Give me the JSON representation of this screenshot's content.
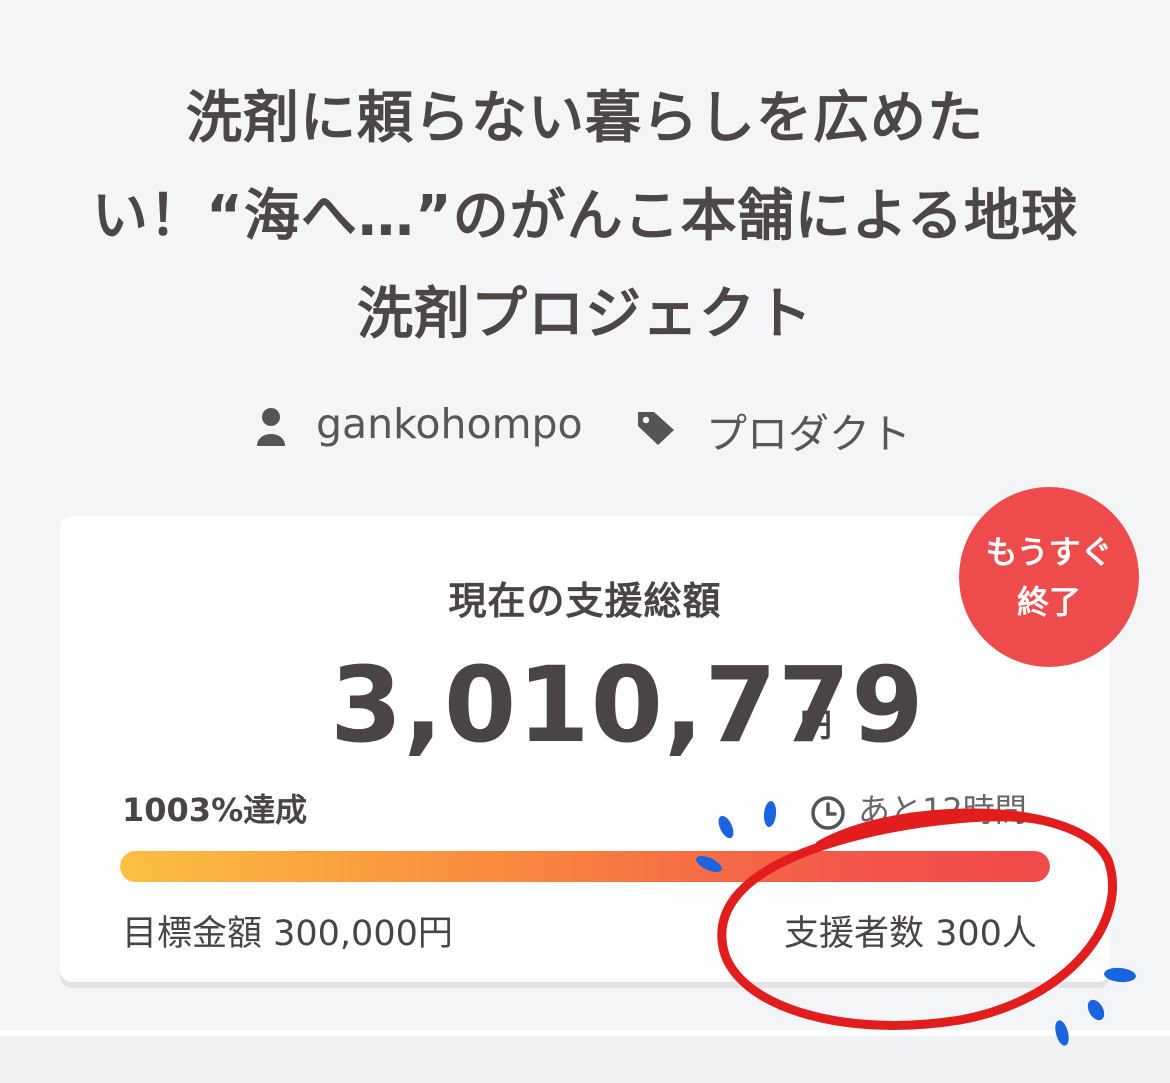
{
  "project": {
    "title_lines": [
      "洗剤に頼らない暮らしを広めた",
      "い！“海へ…”のがんこ本舗による地球",
      "洗剤プロジェクト"
    ],
    "author": "gankohompo",
    "category": "プロダクト"
  },
  "funding": {
    "badge_line1": "もうすぐ",
    "badge_line2": "終了",
    "total_label": "現在の支援総額",
    "total_amount": "3,010,779",
    "currency": "円",
    "achievement": "1003%達成",
    "remaining": "あと12時間",
    "progress_fraction": 1.0,
    "goal": "目標金額 300,000円",
    "backers": "支援者数 300人"
  },
  "colors": {
    "badge": "#ee4c4c",
    "annotation_circle": "#e21d1d",
    "annotation_marks": "#1a64e0",
    "bar_start": "#fbc042",
    "bar_end": "#f04a4a"
  },
  "icons": [
    "user-icon",
    "tag-icon",
    "clock-icon"
  ]
}
